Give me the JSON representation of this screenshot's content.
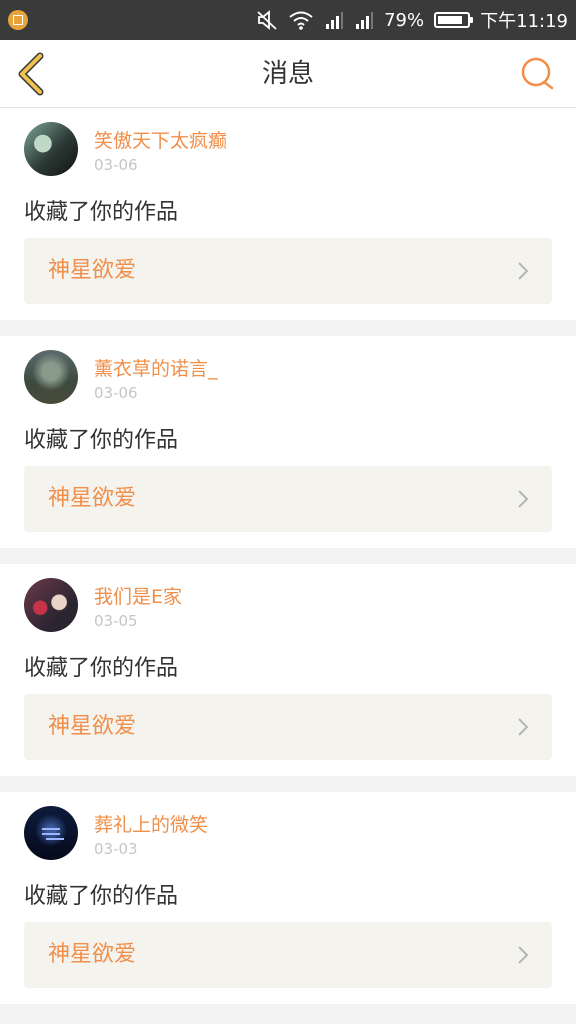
{
  "status_bar": {
    "battery": "79%",
    "battery_level": 0.79,
    "time": "下午11:19",
    "icons": [
      "app-notification-icon",
      "mute-icon",
      "wifi-icon",
      "signal-icon",
      "signal-icon",
      "battery-icon"
    ]
  },
  "header": {
    "title": "消息",
    "back_icon": "chevron-left-icon",
    "search_icon": "search-icon"
  },
  "colors": {
    "accent": "#f08f4a",
    "back_accent": "#e8b84a",
    "card_link_bg": "#f4f3ee",
    "page_bg": "#f3f3f3"
  },
  "messages": [
    {
      "username": "笑傲天下太疯癫",
      "date": "03-06",
      "action": "收藏了你的作品",
      "work_title": "神星欲爱"
    },
    {
      "username": "薰衣草的诺言_",
      "date": "03-06",
      "action": "收藏了你的作品",
      "work_title": "神星欲爱"
    },
    {
      "username": "我们是E家",
      "date": "03-05",
      "action": "收藏了你的作品",
      "work_title": "神星欲爱"
    },
    {
      "username": "葬礼上的微笑",
      "date": "03-03",
      "action": "收藏了你的作品",
      "work_title": "神星欲爱"
    }
  ]
}
